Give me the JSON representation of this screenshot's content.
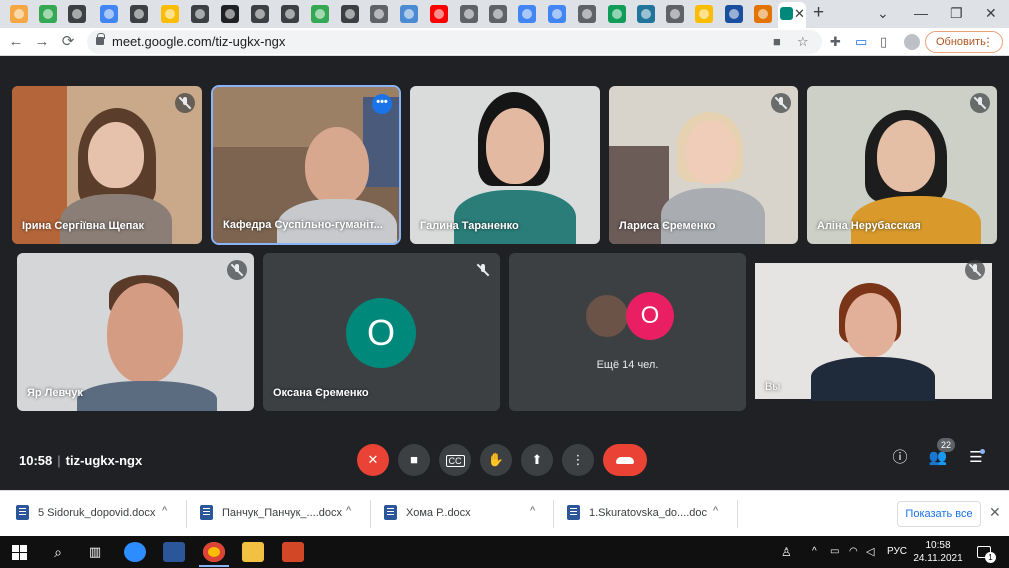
{
  "browser": {
    "tab_close": "✕",
    "new_tab": "+",
    "url": "meet.google.com/tiz-ugkx-ngx",
    "update_label": "Обновить",
    "menu_dots": "⋮",
    "back": "←",
    "forward": "→",
    "reload": "⟳"
  },
  "meeting": {
    "time": "10:58",
    "code": "tiz-ugkx-ngx",
    "people_count": "22",
    "participants": [
      {
        "name": "Ірина Сергіївна Щепак"
      },
      {
        "name": "Кафедра Суспільно-гуманіт..."
      },
      {
        "name": "Галина Тараненко"
      },
      {
        "name": "Лариса Єременко"
      },
      {
        "name": "Аліна Нерубасская"
      },
      {
        "name": "Яр Левчук"
      },
      {
        "name": "Оксана Єременко",
        "initial": "О",
        "avatar_color": "#00897b"
      },
      {
        "more_label": "Ещё 14 чел.",
        "initial": "О",
        "avatar_color": "#e91e63"
      },
      {
        "name": "Вы"
      }
    ],
    "controls": {
      "mic_color": "#ea4335",
      "hangup_color": "#ea4335",
      "cc_label": "CC"
    }
  },
  "downloads": {
    "items": [
      {
        "name": "5 Sidoruk_dopovid.docx"
      },
      {
        "name": "Панчук_Панчук_....docx"
      },
      {
        "name": "Хома Р..docx"
      },
      {
        "name": "1.Skuratovska_do....doc"
      }
    ],
    "chevron": "^",
    "show_all": "Показать все",
    "close": "✕"
  },
  "taskbar": {
    "lang": "РУС",
    "time": "10:58",
    "date": "24.11.2021",
    "notif_count": "1"
  }
}
